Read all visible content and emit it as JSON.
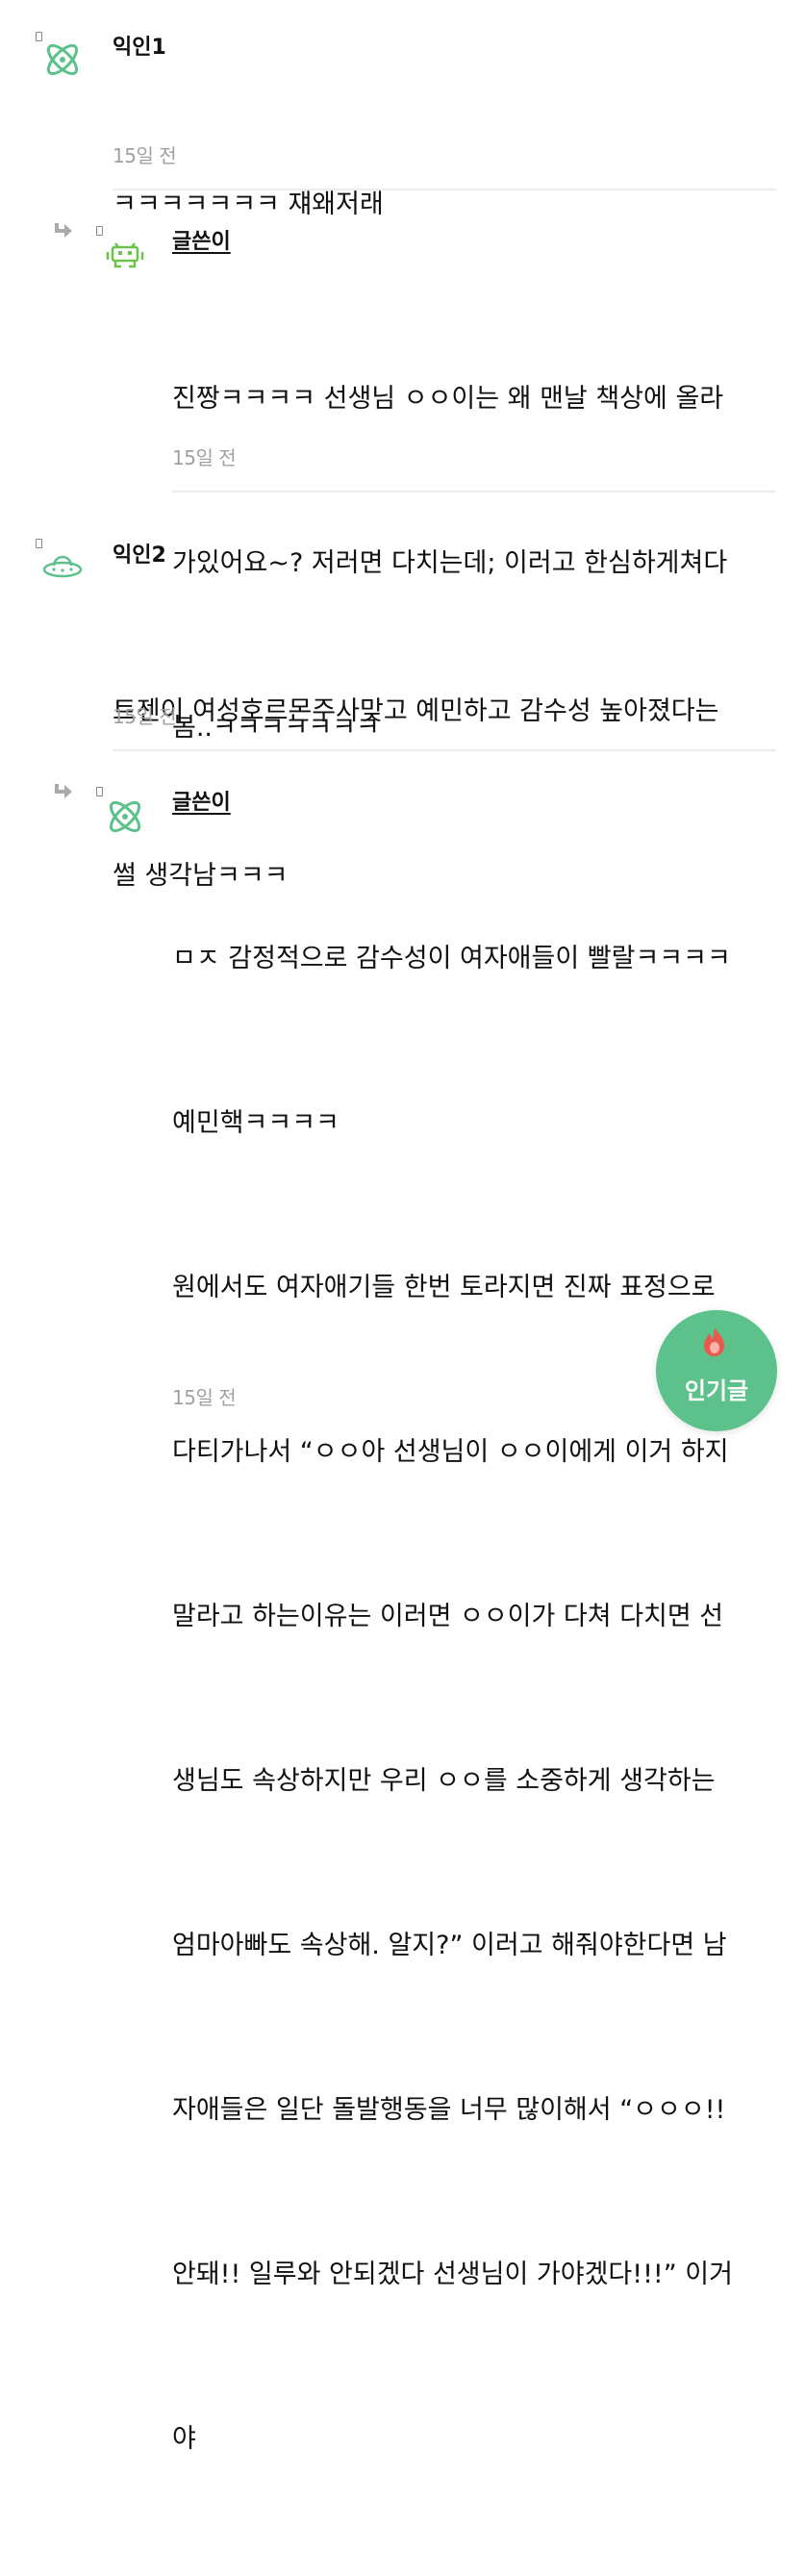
{
  "comments": [
    {
      "name": "익인1",
      "is_reply": false,
      "avatar_icon": "atom-icon",
      "lines": [
        "ㅋㅋㅋㅋㅋㅋㅋ 쟤왜저래"
      ],
      "time": "15일 전"
    },
    {
      "name": "글쓴이",
      "is_reply": true,
      "avatar_icon": "space-invader-icon",
      "lines": [
        "진짱ㅋㅋㅋㅋ 선생님 ㅇㅇ이는 왜 맨날 책상에 올라",
        "가있어요~? 저러면 다치는데; 이러고 한심하게쳐다",
        "봄..ㅋㅋㅋㅋㅋㅋㅋ"
      ],
      "time": "15일 전"
    },
    {
      "name": "익인2",
      "is_reply": false,
      "avatar_icon": "ufo-icon",
      "lines": [
        "트젠이 여성호르몬주사맞고 예민하고 감수성 높아졌다는",
        "썰 생각남ㅋㅋㅋ"
      ],
      "time": "15일 전"
    },
    {
      "name": "글쓴이",
      "is_reply": true,
      "avatar_icon": "atom-icon",
      "lines": [
        "ㅁㅈ 감정적으로 감수성이 여자애들이 빨랄ㅋㅋㅋㅋ",
        "예민핵ㅋㅋㅋㅋ",
        "원에서도 여자애기들 한번 토라지면 진짜 표정으로",
        "다티가나서 “ㅇㅇ아 선생님이 ㅇㅇ이에게 이거 하지",
        "말라고 하는이유는 이러면 ㅇㅇ이가 다쳐 다치면 선",
        "생님도 속상하지만 우리 ㅇㅇ를 소중하게 생각하는",
        "엄마아빠도 속상해. 알지?” 이러고 해줘야한다면 남",
        "자애들은 일단 돌발행동을 너무 많이해서 “ㅇㅇㅇ!!",
        "안돼!! 일루와 안되겠다 선생님이 가야겠다!!!” 이거",
        "야"
      ],
      "time": "15일 전"
    }
  ],
  "fab": {
    "label": "인기글",
    "icon": "fire-icon"
  },
  "colors": {
    "accent": "#5cc18b",
    "time": "#a0a0a0",
    "divider": "#ececec"
  }
}
